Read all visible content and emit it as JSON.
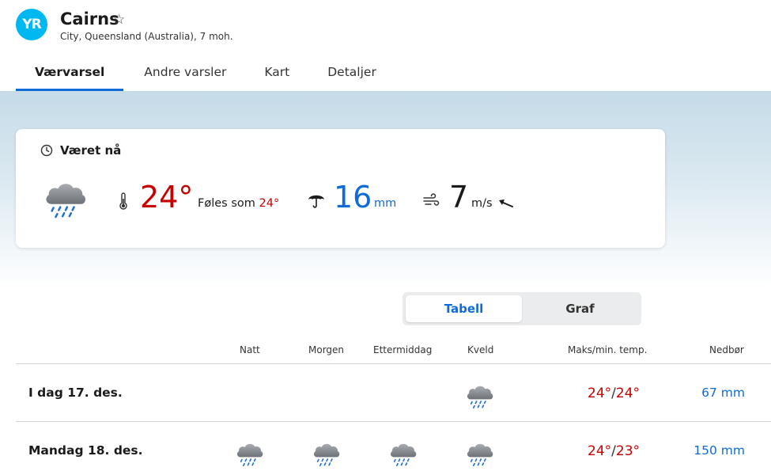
{
  "header": {
    "logo_text": "YR",
    "location_name": "Cairns",
    "location_subtitle": "City, Queensland (Australia), 7 moh.",
    "favorite_icon": "star-outline-icon",
    "tabs": [
      {
        "label": "Værvarsel",
        "active": true
      },
      {
        "label": "Andre varsler",
        "active": false
      },
      {
        "label": "Kart",
        "active": false
      },
      {
        "label": "Detaljer",
        "active": false
      }
    ]
  },
  "now": {
    "title": "Været nå",
    "symbol": "rain-cloud-icon",
    "temperature": "24°",
    "feels_like_label": "Føles som",
    "feels_like_value": "24°",
    "precipitation": "16",
    "precipitation_unit": "mm",
    "wind": "7",
    "wind_unit": "m/s",
    "wind_direction_icon": "wind-arrow-icon"
  },
  "view_toggle": {
    "options": [
      "Tabell",
      "Graf"
    ],
    "selected": "Tabell"
  },
  "table": {
    "headers": {
      "natt": "Natt",
      "morgen": "Morgen",
      "ettermiddag": "Ettermiddag",
      "kveld": "Kveld",
      "temp": "Maks/min. temp.",
      "precip": "Nedbør"
    },
    "rows": [
      {
        "day": "I dag 17. des.",
        "symbols": {
          "natt": null,
          "morgen": null,
          "ettermiddag": null,
          "kveld": "rain-cloud-icon"
        },
        "max": "24°",
        "separator": "/",
        "min": "24°",
        "precip": "67 mm"
      },
      {
        "day": "Mandag 18. des.",
        "symbols": {
          "natt": "rain-cloud-icon",
          "morgen": "rain-cloud-icon",
          "ettermiddag": "rain-cloud-icon",
          "kveld": "rain-cloud-icon"
        },
        "max": "24°",
        "separator": "/",
        "min": "23°",
        "precip": "150 mm"
      }
    ]
  },
  "colors": {
    "accent_blue": "#0e6bd8",
    "temp_red": "#c60000",
    "logo_cyan": "#00b8f1"
  }
}
